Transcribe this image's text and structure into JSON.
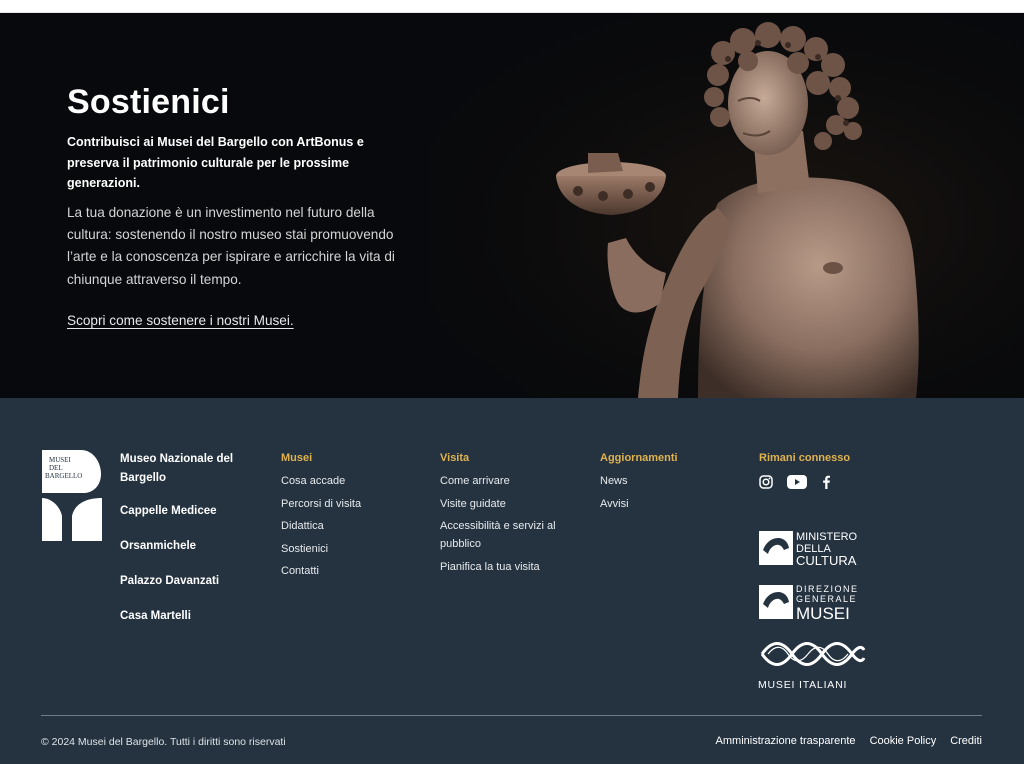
{
  "hero": {
    "title": "Sostienici",
    "lead": "Contribuisci ai Musei del Bargello con ArtBonus e preserva il patrimonio culturale per le prossime generazioni.",
    "body": "La tua donazione è un investimento nel futuro della cultura: sostenendo il nostro museo stai promuovendo l’arte e la conoscenza per ispirare e arricchire la vita di chiunque attraverso il tempo.",
    "link": "Scopri come sostenere i nostri Musei."
  },
  "footer": {
    "logo_text": [
      "MUSEI",
      "DEL",
      "BARGELLO"
    ],
    "museums": [
      "Museo Nazionale del Bargello",
      "Cappelle Medicee",
      "Orsanmichele",
      "Palazzo Davanzati",
      "Casa Martelli"
    ],
    "columns": [
      {
        "heading": "Musei",
        "links": [
          "Cosa accade",
          "Percorsi di visita",
          "Didattica",
          "Sostienici",
          "Contatti"
        ]
      },
      {
        "heading": "Visita",
        "links": [
          "Come arrivare",
          "Visite guidate",
          "Accessibilità e servizi al pubblico",
          "Pianifica la tua visita"
        ]
      },
      {
        "heading": "Aggiornamenti",
        "links": [
          "News",
          "Avvisi"
        ]
      }
    ],
    "connect": {
      "heading": "Rimani connesso",
      "social": [
        "instagram-icon",
        "youtube-icon",
        "facebook-icon"
      ]
    },
    "institution_logos": {
      "ministero": [
        "MINISTERO",
        "DELLA",
        "CULTURA"
      ],
      "direzione": [
        "DIREZIONE",
        "GENERALE",
        "MUSEI"
      ],
      "mic_mark": "MiC",
      "musei_italiani": "MUSEI ITALIANI"
    },
    "copyright": "© 2024 Musei del Bargello. Tutti i diritti sono riservati",
    "legal_links": [
      "Amministrazione trasparente",
      "Cookie Policy",
      "Crediti"
    ]
  },
  "colors": {
    "hero_bg": "#07090c",
    "footer_bg": "#253340",
    "accent_gold": "#e0b24e"
  }
}
